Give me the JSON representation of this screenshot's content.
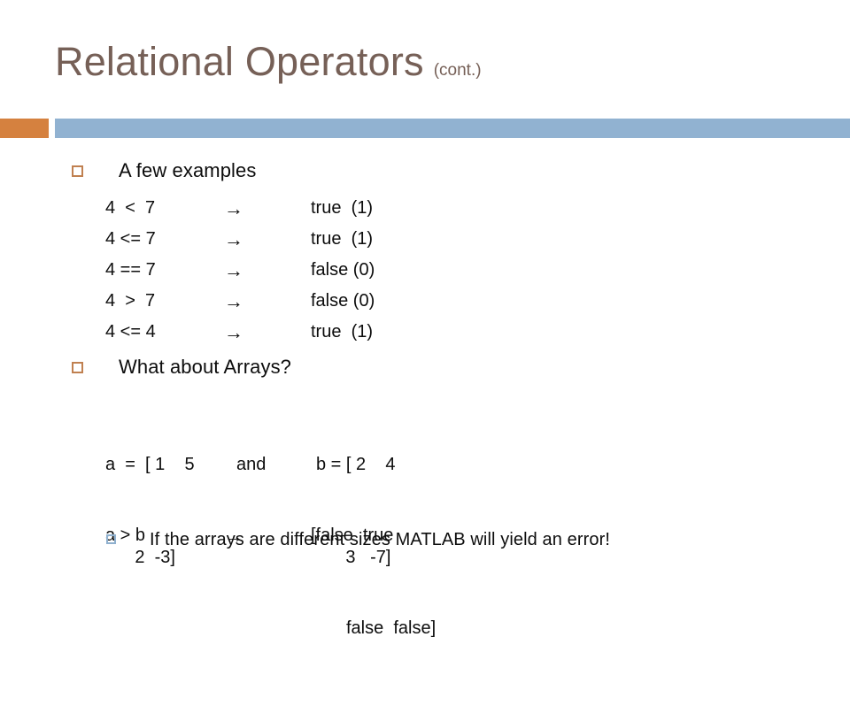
{
  "slide": {
    "title": "Relational Operators",
    "title_suffix": "(cont.)",
    "accent_orange": "#d5813f",
    "accent_blue": "#91b2d1",
    "title_color": "#766057",
    "body_color": "#0d0d0d",
    "background": "#ffffff"
  },
  "bullets": {
    "examples_label": "A few examples",
    "arrays_label": "What about Arrays?",
    "error_label": "If the arrays are different sizes MATLAB will yield an error!"
  },
  "examples": {
    "rows": [
      {
        "expression": "4  <  7",
        "arrow": "→",
        "result": "true  (1)"
      },
      {
        "expression": "4 <= 7",
        "arrow": "→",
        "result": "true  (1)"
      },
      {
        "expression": "4 == 7",
        "arrow": "→",
        "result": "false (0)"
      },
      {
        "expression": "4  >  7",
        "arrow": "→",
        "result": "false (0)"
      },
      {
        "expression": "4 <= 4",
        "arrow": "→",
        "result": "true  (1)"
      }
    ]
  },
  "arrays": {
    "definition_line1": {
      "a": "a  =  [ 1    5",
      "conjunction": "and",
      "b": "b = [ 2    4"
    },
    "definition_line2": {
      "a": "      2  -3]",
      "conjunction": "",
      "b": "      3   -7]"
    },
    "comparison": {
      "expression": "a > b",
      "arrow": "→",
      "result_line1": "[false  true",
      "result_line2": "false  false]"
    }
  },
  "icons": {
    "bullet_square_orange": "square-outline-icon",
    "bullet_square_blue": "square-outline-icon",
    "arrow_right": "arrow-right-icon"
  }
}
